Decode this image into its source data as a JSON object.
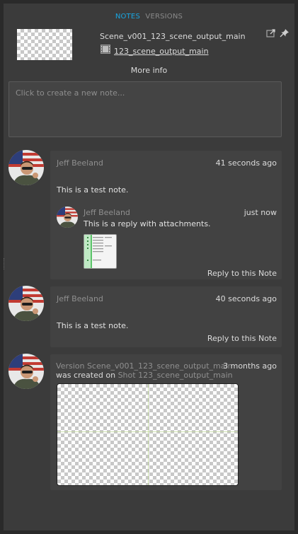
{
  "tabs": {
    "notes": "NOTES",
    "versions": "VERSIONS"
  },
  "colors": {
    "accent": "#18a7e3",
    "panel_bg": "#3b3b3b",
    "bubble_bg": "#424242"
  },
  "header": {
    "version_name": "Scene_v001_123_scene_output_main",
    "entity_icon": "film-icon",
    "entity_link": "123_scene_output_main",
    "more_info": "More info",
    "icons": [
      "reply-to-version-icon",
      "pin-icon"
    ]
  },
  "new_note": {
    "placeholder": "Click to create a new note..."
  },
  "notes": [
    {
      "author": "Jeff Beeland",
      "time": "41 seconds ago",
      "text": "This is a test note.",
      "reply": {
        "author": "Jeff Beeland",
        "time": "just now",
        "text": "This is a reply with attachments."
      },
      "reply_link": "Reply to this Note"
    },
    {
      "author": "Jeff Beeland",
      "time": "40 seconds ago",
      "text": "This is a test note.",
      "reply_link": "Reply to this Note"
    }
  ],
  "activity": {
    "version_label": "Version Scene_v001_123_scene_output_main",
    "created_on": "was created on",
    "shot_label": "Shot 123_scene_output_main",
    "time": "3 months ago"
  }
}
